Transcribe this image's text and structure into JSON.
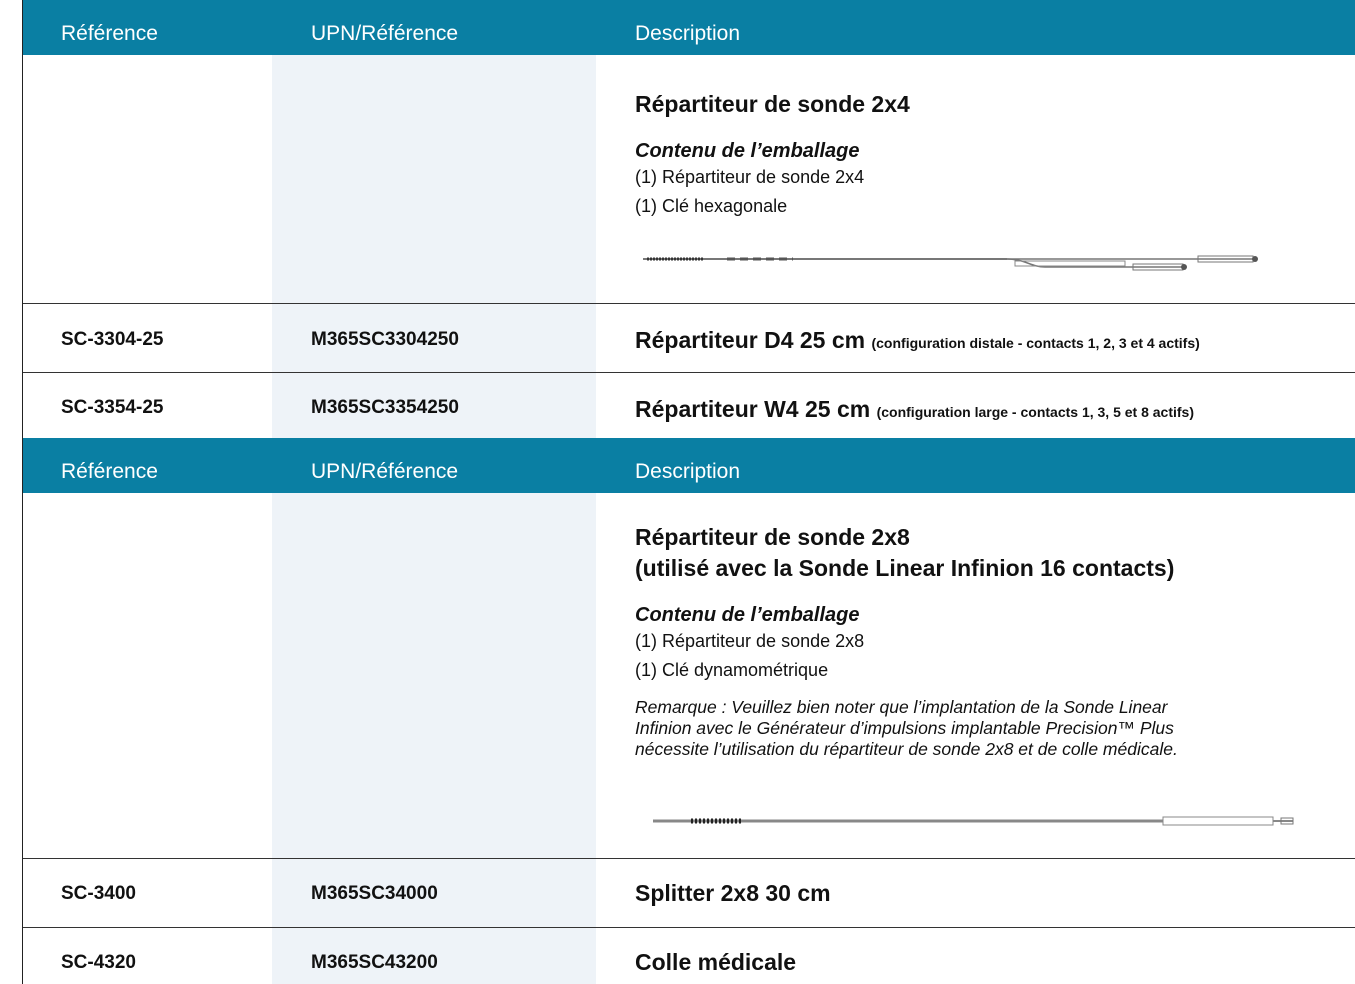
{
  "headers": [
    "Référence",
    "UPN/Référence",
    "Description"
  ],
  "section1": {
    "title": "Répartiteur de sonde 2x4",
    "contents_heading": "Contenu de l’emballage",
    "items": [
      "(1) Répartiteur de sonde 2x4",
      "(1) Clé hexagonale"
    ],
    "image": "lead-splitter-2x4-drawing"
  },
  "rows1": [
    {
      "ref": "SC-3304-25",
      "upn": "M365SC3304250",
      "desc": "Répartiteur D4 25 cm",
      "note": "(configuration distale - contacts 1, 2, 3 et 4 actifs)"
    },
    {
      "ref": "SC-3354-25",
      "upn": "M365SC3354250",
      "desc": "Répartiteur W4 25 cm",
      "note": "(configuration large - contacts 1, 3, 5 et 8 actifs)"
    }
  ],
  "section2": {
    "title_line1": "Répartiteur de sonde 2x8",
    "title_line2": "(utilisé avec la Sonde Linear Infinion 16 contacts)",
    "contents_heading": "Contenu de l’emballage",
    "items": [
      "(1) Répartiteur de sonde 2x8",
      "(1) Clé dynamométrique"
    ],
    "remark_lines": [
      "Remarque : Veuillez bien noter que l’implantation de la Sonde Linear",
      "Infinion avec le Générateur d’impulsions implantable Precision™ Plus",
      "nécessite l’utilisation du répartiteur de sonde 2x8 et de colle médicale."
    ],
    "image": "lead-splitter-2x8-drawing"
  },
  "rows2": [
    {
      "ref": "SC-3400",
      "upn": "M365SC34000",
      "desc": "Splitter 2x8 30 cm"
    },
    {
      "ref": "SC-4320",
      "upn": "M365SC43200",
      "desc": "Colle médicale"
    }
  ]
}
